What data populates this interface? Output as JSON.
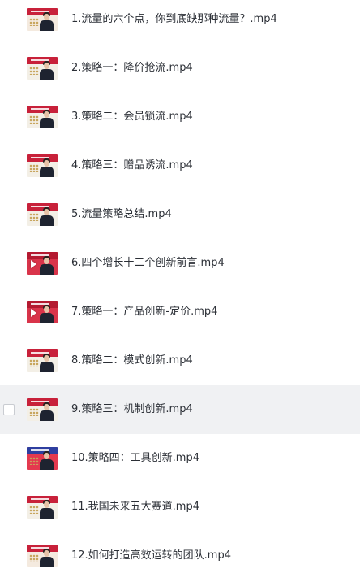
{
  "files": [
    {
      "name": "1.流量的六个点，你到底缺那种流量？.mp4",
      "thumb_icon": "video-thumbnail-icon",
      "thumb_bg": "#f4eadf",
      "thumb_band": "#c8213a",
      "play": false
    },
    {
      "name": "2.策略一：降价抢流.mp4",
      "thumb_icon": "video-thumbnail-icon",
      "thumb_bg": "#f3efe6",
      "thumb_band": "#c8213a",
      "play": false
    },
    {
      "name": "3.策略二：会员锁流.mp4",
      "thumb_icon": "video-thumbnail-icon",
      "thumb_bg": "#f3efe6",
      "thumb_band": "#c8213a",
      "play": false
    },
    {
      "name": "4.策略三：赠品诱流.mp4",
      "thumb_icon": "video-thumbnail-icon",
      "thumb_bg": "#f3efe6",
      "thumb_band": "#c8213a",
      "play": false
    },
    {
      "name": "5.流量策略总结.mp4",
      "thumb_icon": "video-thumbnail-icon",
      "thumb_bg": "#f3efe6",
      "thumb_band": "#c8213a",
      "play": false
    },
    {
      "name": "6.四个增长十二个创新前言.mp4",
      "thumb_icon": "video-thumbnail-icon",
      "thumb_bg": "#d9344a",
      "thumb_band": "#b41a30",
      "play": true
    },
    {
      "name": "7.策略一：产品创新-定价.mp4",
      "thumb_icon": "video-thumbnail-icon",
      "thumb_bg": "#d9344a",
      "thumb_band": "#b41a30",
      "play": true
    },
    {
      "name": "8.策略二：模式创新.mp4",
      "thumb_icon": "video-thumbnail-icon",
      "thumb_bg": "#f3efe6",
      "thumb_band": "#c8213a",
      "play": false
    },
    {
      "name": "9.策略三：机制创新.mp4",
      "thumb_icon": "video-thumbnail-icon",
      "thumb_bg": "#f3efe6",
      "thumb_band": "#c8213a",
      "play": false,
      "selected": true
    },
    {
      "name": "10.策略四：工具创新.mp4",
      "thumb_icon": "video-thumbnail-icon",
      "thumb_bg": "#e4394f",
      "thumb_band": "#2e3fa0",
      "play": false
    },
    {
      "name": "11.我国未来五大赛道.mp4",
      "thumb_icon": "video-thumbnail-icon",
      "thumb_bg": "#f3efe6",
      "thumb_band": "#c8213a",
      "play": false
    },
    {
      "name": "12.如何打造高效运转的团队.mp4",
      "thumb_icon": "video-thumbnail-icon",
      "thumb_bg": "#f4eadf",
      "thumb_band": "#c8213a",
      "play": false
    }
  ]
}
